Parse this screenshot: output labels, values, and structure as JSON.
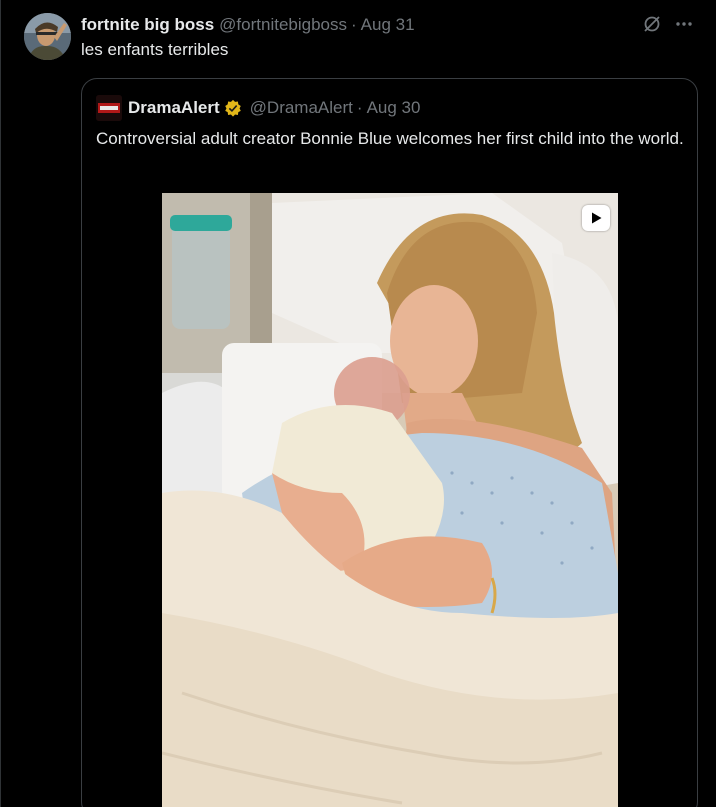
{
  "tweet": {
    "display_name": "fortnite big boss",
    "handle": "@fortnitebigboss",
    "separator": "·",
    "date": "Aug 31",
    "text": "les enfants terribles"
  },
  "actions": {
    "grok_icon": "grok-icon",
    "more_icon": "more-icon"
  },
  "quoted": {
    "display_name": "DramaAlert",
    "verified": true,
    "handle": "@DramaAlert",
    "separator": "·",
    "date": "Aug 30",
    "text": "Controversial adult creator Bonnie Blue welcomes her first child into the world.",
    "media_type": "video",
    "media_badge_icon": "play-icon"
  },
  "colors": {
    "background": "#000000",
    "text_primary": "#e7e9ea",
    "text_secondary": "#71767b",
    "border": "#3a3e42",
    "verified_gold": "#e2b719"
  }
}
